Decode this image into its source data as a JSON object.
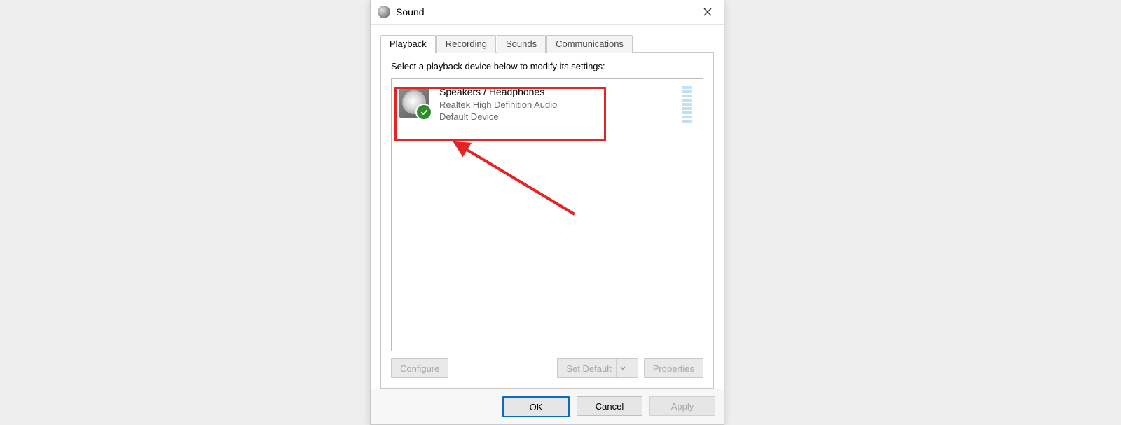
{
  "window": {
    "title": "Sound"
  },
  "tabs": {
    "playback": "Playback",
    "recording": "Recording",
    "sounds": "Sounds",
    "communications": "Communications"
  },
  "instruction": "Select a playback device below to modify its settings:",
  "device": {
    "name": "Speakers / Headphones",
    "driver": "Realtek High Definition Audio",
    "status": "Default Device"
  },
  "buttons": {
    "configure": "Configure",
    "set_default": "Set Default",
    "properties": "Properties",
    "ok": "OK",
    "cancel": "Cancel",
    "apply": "Apply"
  }
}
